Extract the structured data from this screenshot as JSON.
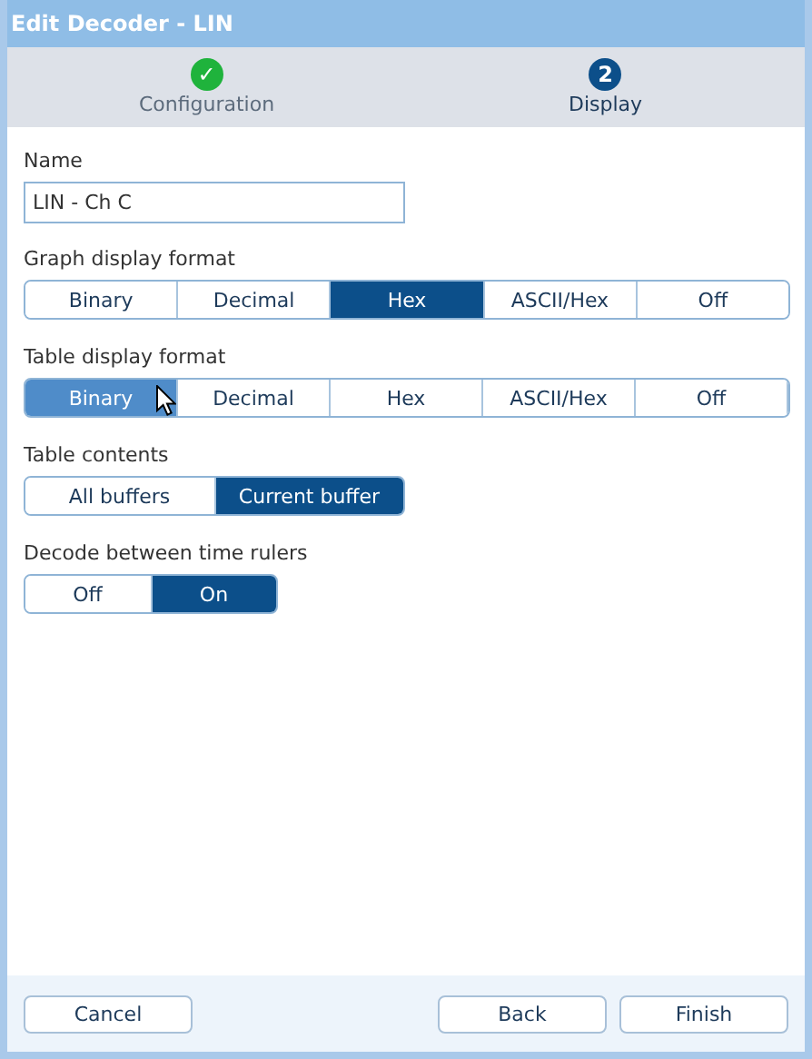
{
  "window": {
    "title": "Edit Decoder - LIN"
  },
  "steps": [
    {
      "kind": "done",
      "icon": "✓",
      "label": "Configuration"
    },
    {
      "kind": "current",
      "icon": "2",
      "label": "Display"
    }
  ],
  "name_field": {
    "label": "Name",
    "value": "LIN - Ch C"
  },
  "groups": [
    {
      "label": "Graph display format",
      "options": [
        {
          "label": "Binary",
          "selected": false
        },
        {
          "label": "Decimal",
          "selected": false
        },
        {
          "label": "Hex",
          "selected": true
        },
        {
          "label": "ASCII/Hex",
          "selected": false
        },
        {
          "label": "Off",
          "selected": false
        }
      ]
    },
    {
      "label": "Table display format",
      "options": [
        {
          "label": "Binary",
          "selected": true,
          "hovered": true
        },
        {
          "label": "Decimal",
          "selected": false
        },
        {
          "label": "Hex",
          "selected": false
        },
        {
          "label": "ASCII/Hex",
          "selected": false
        },
        {
          "label": "Off",
          "selected": false
        }
      ]
    },
    {
      "label": "Table contents",
      "options": [
        {
          "label": "All buffers",
          "selected": false
        },
        {
          "label": "Current buffer",
          "selected": true
        }
      ]
    },
    {
      "label": "Decode between time rulers",
      "options": [
        {
          "label": "Off",
          "selected": false
        },
        {
          "label": "On",
          "selected": true
        }
      ]
    }
  ],
  "buttons": {
    "left": [
      "Cancel"
    ],
    "right": [
      "Back",
      "Finish"
    ]
  }
}
